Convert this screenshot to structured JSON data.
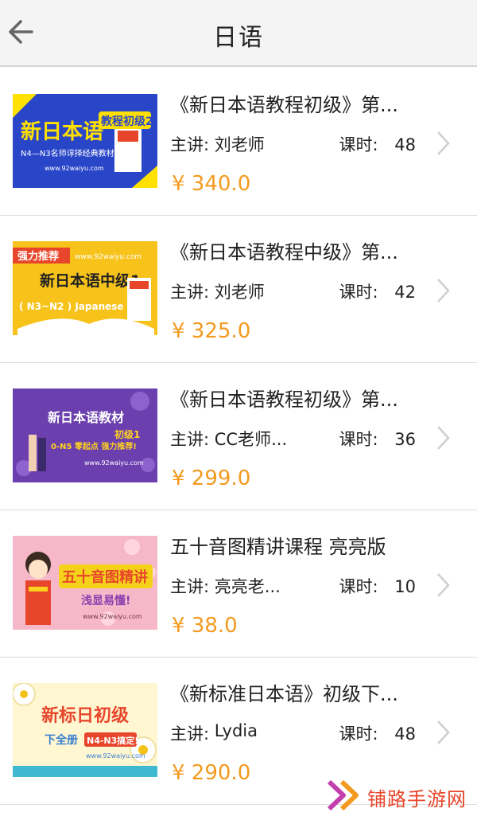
{
  "header": {
    "title": "日语",
    "back_icon": "arrow-left-icon"
  },
  "courses": [
    {
      "title": "《新日本语教程初级》第...",
      "teacher_label": "主讲:",
      "teacher": "刘老师",
      "hours_label": "课时:",
      "hours": "48",
      "price": "¥ 340.0",
      "thumb": {
        "bg": "#2a46c8",
        "accent": "#ffe000",
        "main": "新日本语",
        "tag": "教程初级2",
        "sub": "N4—N3名师谆择经典教材",
        "url": "www.92waiyu.com"
      }
    },
    {
      "title": "《新日本语教程中级》第...",
      "teacher_label": "主讲:",
      "teacher": "刘老师",
      "hours_label": "课时:",
      "hours": "42",
      "price": "¥ 325.0",
      "thumb": {
        "bg": "#f7c21a",
        "accent": "#e8462b",
        "main": "新日本语中级1",
        "tag": "强力推荐",
        "sub": "( N3~N2 )  Japanese",
        "url": "www.92waiyu.com"
      }
    },
    {
      "title": "《新日本语教程初级》第...",
      "teacher_label": "主讲:",
      "teacher": "CC老师...",
      "hours_label": "课时:",
      "hours": "36",
      "price": "¥ 299.0",
      "thumb": {
        "bg": "#6b3fae",
        "accent": "#ffd21f",
        "main": "新日本语教材",
        "tag": "初级1",
        "sub": "0-N5  零起点 强力推荐!",
        "url": "www.92waiyu.com"
      }
    },
    {
      "title": "五十音图精讲课程 亮亮版",
      "teacher_label": "主讲:",
      "teacher": "亮亮老...",
      "hours_label": "课时:",
      "hours": "10",
      "price": "¥ 38.0",
      "thumb": {
        "bg": "#f6b8c8",
        "accent": "#e8462b",
        "main": "五十音图精讲",
        "tag": "浅显易懂!",
        "sub": "",
        "url": "www.92waiyu.com"
      }
    },
    {
      "title": "《新标准日本语》初级下...",
      "teacher_label": "主讲:",
      "teacher": "Lydia",
      "hours_label": "课时:",
      "hours": "48",
      "price": "¥ 290.0",
      "thumb": {
        "bg": "#fff6d2",
        "accent": "#e8462b",
        "main": "新标日初级",
        "tag": "下全册",
        "sub": "N4-N3搞定!",
        "url": "www.92waiyu.com"
      }
    }
  ],
  "watermark": {
    "text": "铺路手游网",
    "icon": "double-chevron-logo-icon"
  },
  "colors": {
    "price": "#f39a1f",
    "divider": "#dcdcdc",
    "header_bg": "#f4f4f4"
  }
}
